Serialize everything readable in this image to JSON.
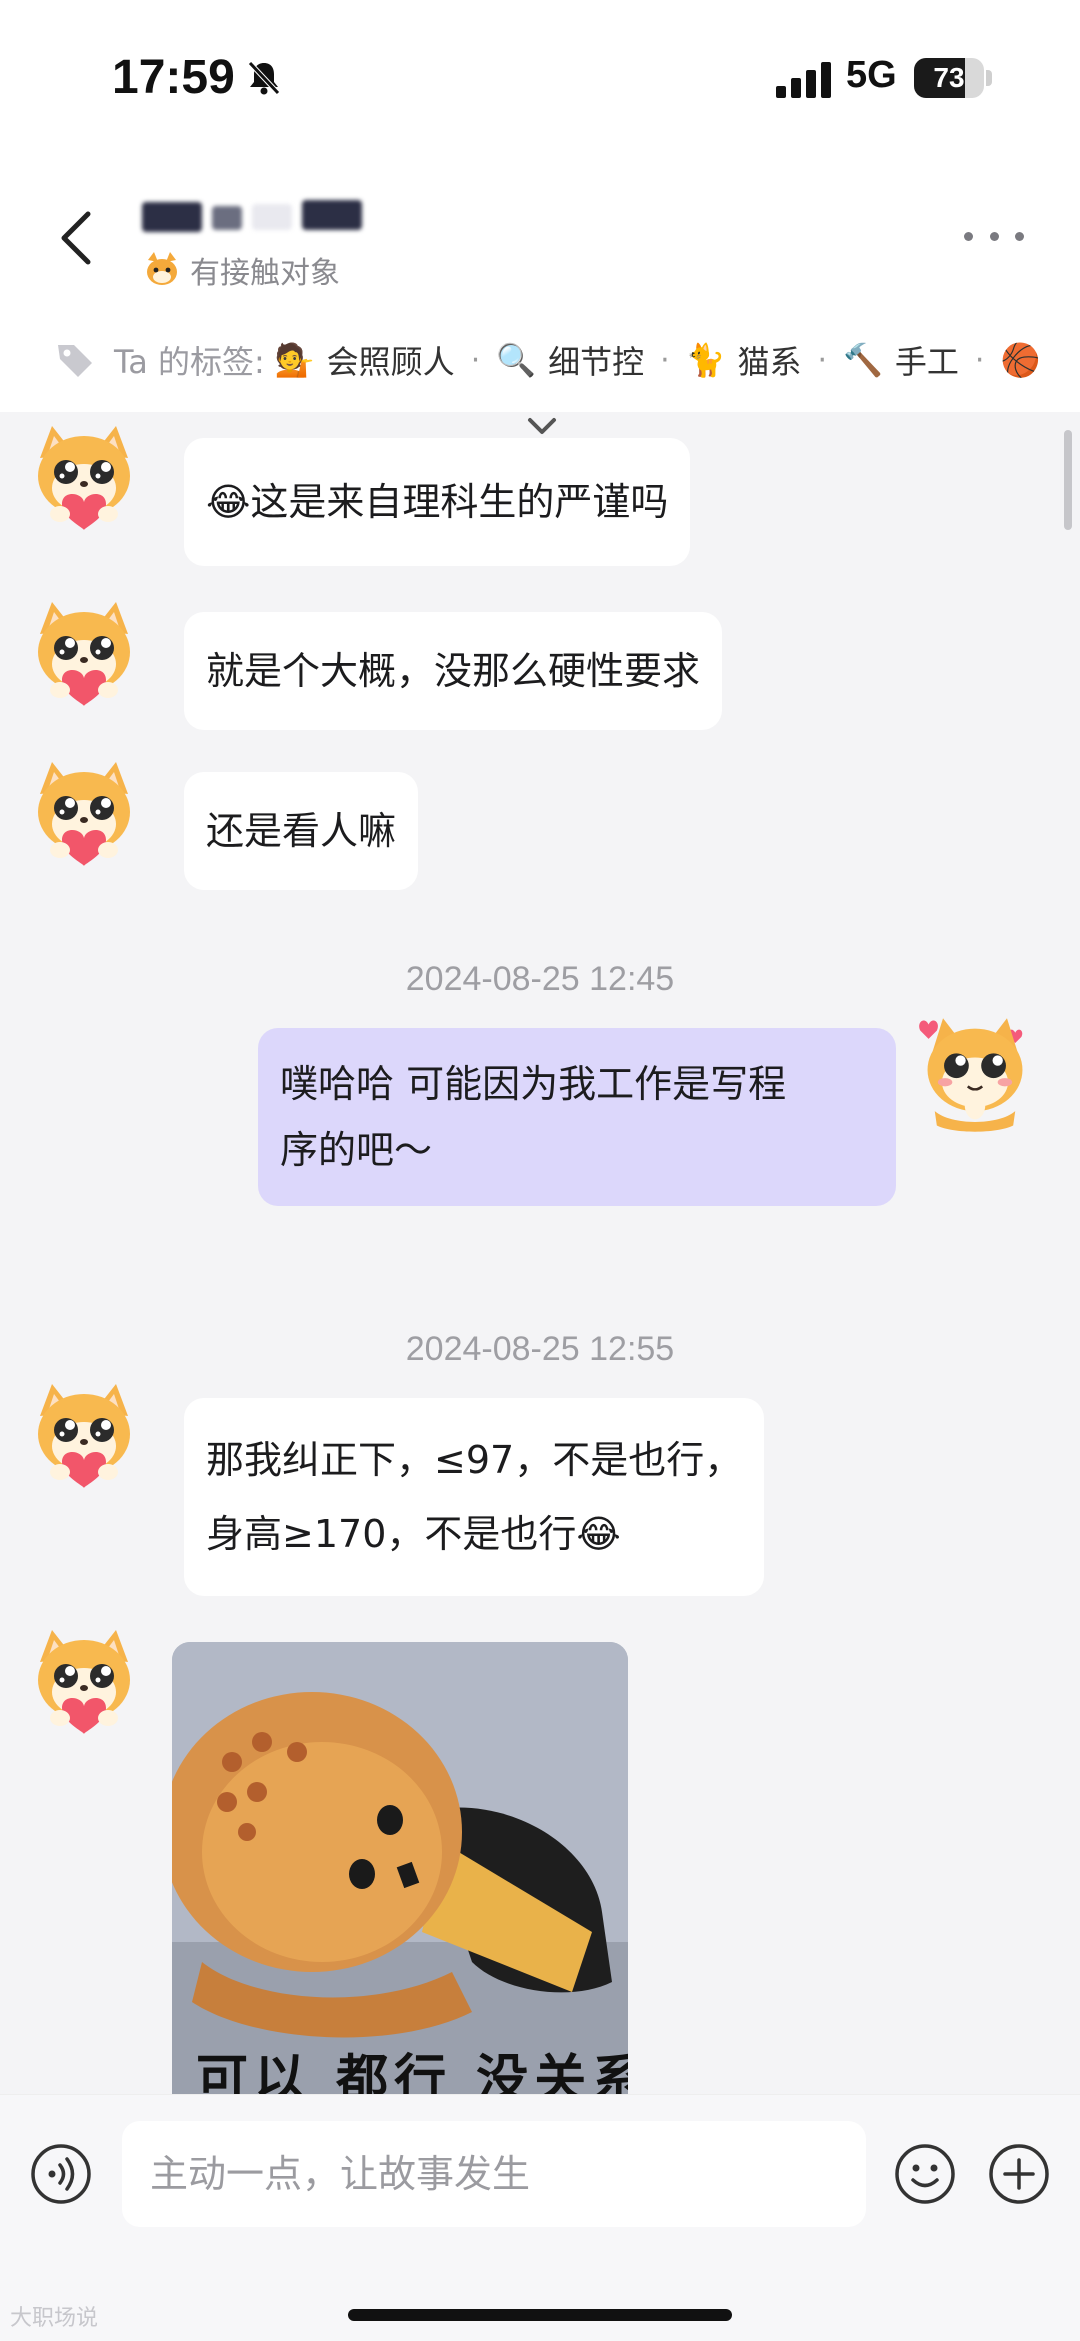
{
  "status_bar": {
    "time": "17:59",
    "network": "5G",
    "battery": "73",
    "icons": [
      "bell-muted-icon",
      "signal-icon",
      "battery-icon"
    ]
  },
  "header": {
    "contact_status": "有接触对象",
    "tags_label": "Ta 的标签:",
    "tags": [
      {
        "emoji": "💁",
        "label": "会照顾人"
      },
      {
        "emoji": "🔍",
        "label": "细节控"
      },
      {
        "emoji": "🐈",
        "label": "猫系"
      },
      {
        "emoji": "🔨",
        "label": "手工"
      },
      {
        "emoji": "🏀",
        "label": ""
      }
    ],
    "tag_separator": "·"
  },
  "messages": [
    {
      "side": "them",
      "emoji": "😂",
      "text": "这是来自理科生的严谨吗"
    },
    {
      "side": "them",
      "text": "就是个大概，没那么硬性要求"
    },
    {
      "side": "them",
      "text": "还是看人嘛"
    },
    {
      "type": "timestamp",
      "text": "2024-08-25 12:45"
    },
    {
      "side": "me",
      "lines": [
        "噗哈哈 可能因为我工作是写程",
        "序的吧～"
      ]
    },
    {
      "type": "timestamp",
      "text": "2024-08-25 12:55"
    },
    {
      "side": "them",
      "lines": [
        "那我纠正下，≤97，不是也行，",
        "身高≥170，不是也行"
      ],
      "emoji": "😂"
    },
    {
      "side": "them",
      "type": "image",
      "caption": "可以 都行 没关系"
    }
  ],
  "input": {
    "placeholder": "主动一点，让故事发生"
  },
  "watermark": "大职场说",
  "colors": {
    "my_bubble": "#dcd7fb",
    "their_bubble": "#ffffff",
    "background": "#f4f4f6"
  }
}
